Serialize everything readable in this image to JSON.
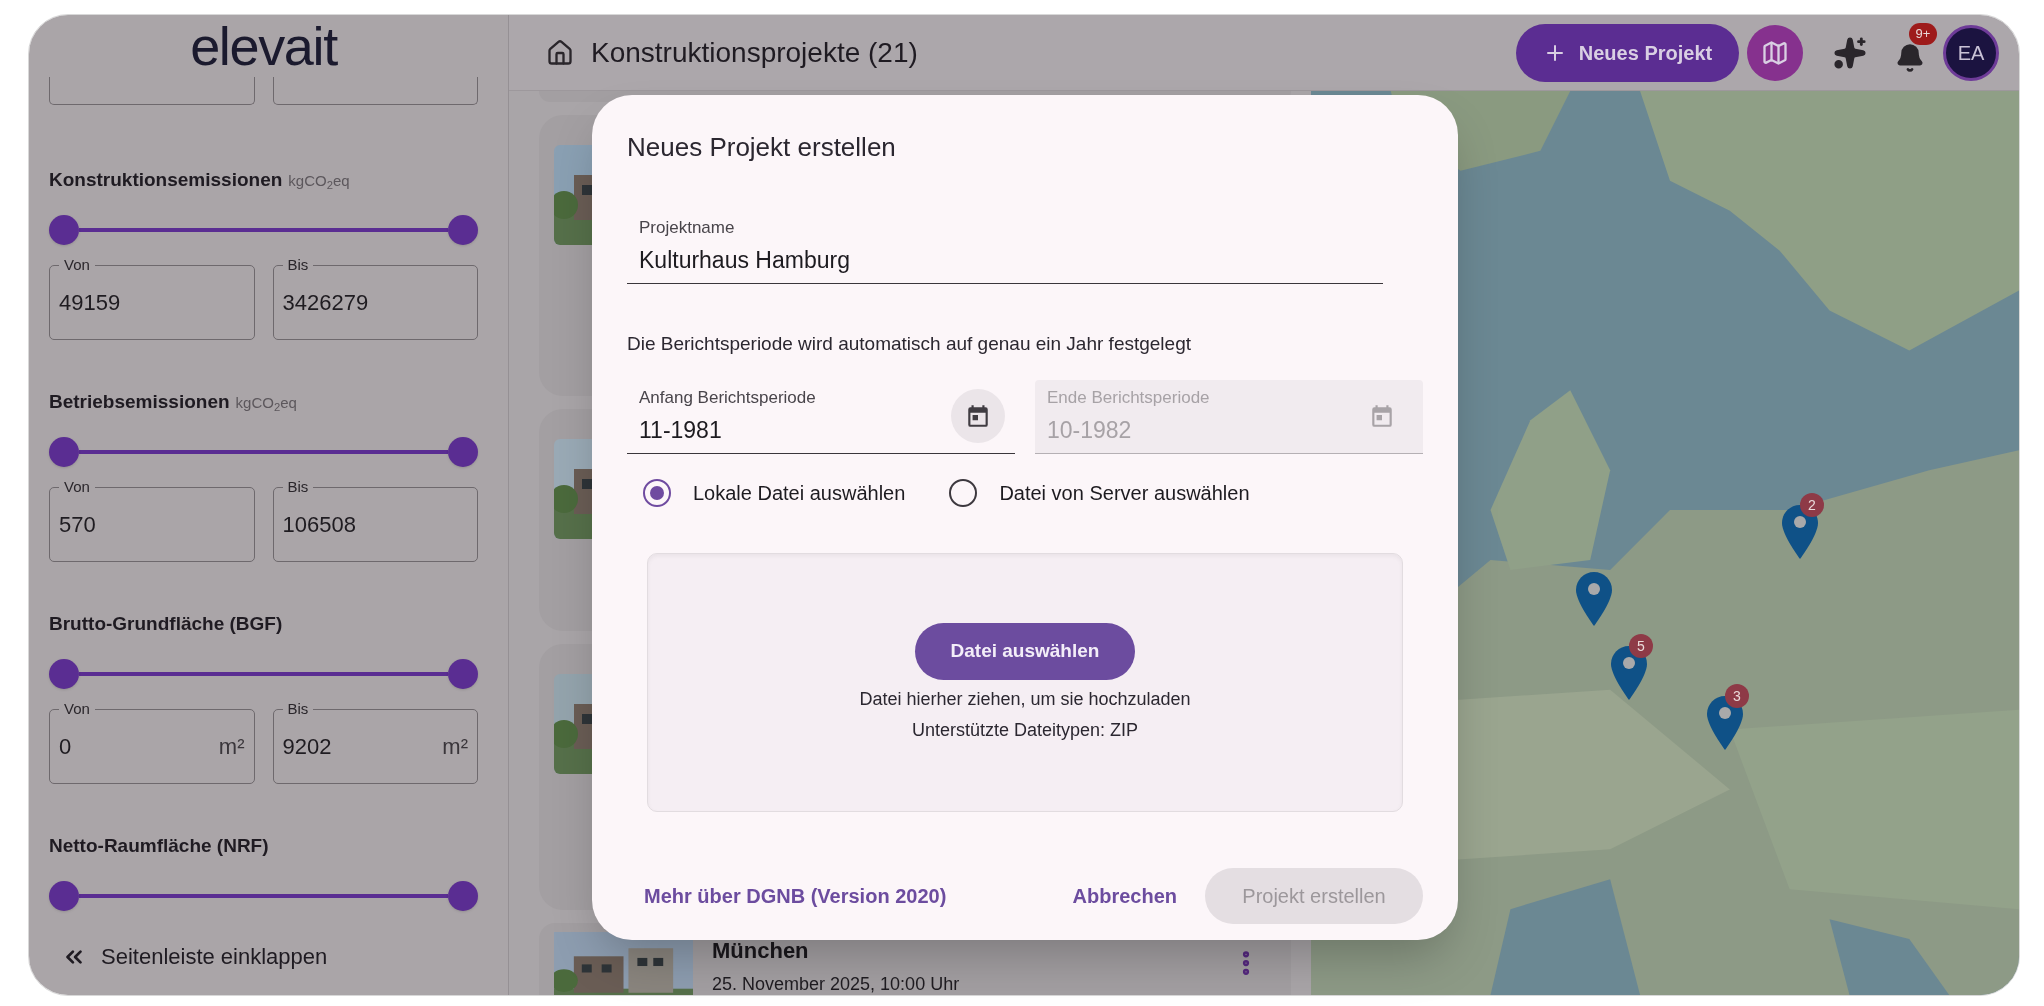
{
  "sidebar": {
    "logo": "elevait",
    "filters": [
      {
        "label": "Konstruktionsemissionen",
        "unit": "kgCO$_{2}$eq",
        "thumbs": [
          {
            "level": 0
          },
          {
            "level": 1
          }
        ],
        "fields": [
          {
            "label": "Von",
            "value": "49159"
          },
          {
            "label": "Bis",
            "value": "3426279"
          }
        ]
      },
      {
        "label": "Betriebsemissionen",
        "unit": "kgCO$_{2}$eq",
        "thumbs": [
          {
            "level": 0
          },
          {
            "level": 1
          }
        ],
        "fields": [
          {
            "label": "Von",
            "value": "570"
          },
          {
            "label": "Bis",
            "value": "106508"
          }
        ]
      },
      {
        "label": "Brutto-Grundfläche (BGF)",
        "thumbs": [
          {
            "level": 0
          },
          {
            "level": 1
          }
        ],
        "fields": [
          {
            "label": "Von",
            "value": "0",
            "suffix": "m²"
          },
          {
            "label": "Bis",
            "value": "9202",
            "suffix": "m²"
          }
        ]
      },
      {
        "label": "Netto-Raumfläche (NRF)",
        "thumbs": [
          {
            "level": 0
          },
          {
            "level": 1
          }
        ]
      }
    ],
    "collapse": "Seitenleiste einklappen"
  },
  "header": {
    "title": "Konstruktionsprojekte (21)",
    "new_button": "Neues Projekt",
    "notification_badge": "9+",
    "avatar": "EA"
  },
  "projects": [
    {
      "kind": "covered"
    },
    {
      "kind": "covered"
    },
    {
      "kind": "covered"
    },
    {
      "kind": "full",
      "title": "München",
      "date": "25. November 2025, 10:00 Uhr"
    }
  ],
  "map": {
    "markers": [
      {
        "kind": "cluster",
        "count": "2"
      },
      {
        "kind": "single"
      },
      {
        "kind": "cluster",
        "count": "5"
      },
      {
        "kind": "cluster",
        "count": "3"
      }
    ]
  },
  "dialog": {
    "title": "Neues Projekt erstellen",
    "name_field": {
      "label": "Projektname",
      "value": "Kulturhaus Hamburg"
    },
    "info": "Die Berichtsperiode wird automatisch auf genau ein Jahr festgelegt",
    "period_fields": [
      {
        "label": "Anfang Berichtsperiode",
        "value": "11-1981",
        "disabled": false
      },
      {
        "label": "Ende Berichtsperiode",
        "value": "10-1982",
        "disabled": true
      }
    ],
    "source_options": [
      {
        "label": "Lokale Datei auswählen",
        "selected": true
      },
      {
        "label": "Datei von Server auswählen",
        "selected": false
      }
    ],
    "dropzone": {
      "button": "Datei auswählen",
      "hint": "Datei hierher ziehen, um sie hochzuladen",
      "types": "Unterstützte Dateitypen: ZIP"
    },
    "link": "Mehr über DGNB (Version 2020)",
    "cancel": "Abbrechen",
    "submit": {
      "label": "Projekt erstellen",
      "disabled": true
    }
  }
}
